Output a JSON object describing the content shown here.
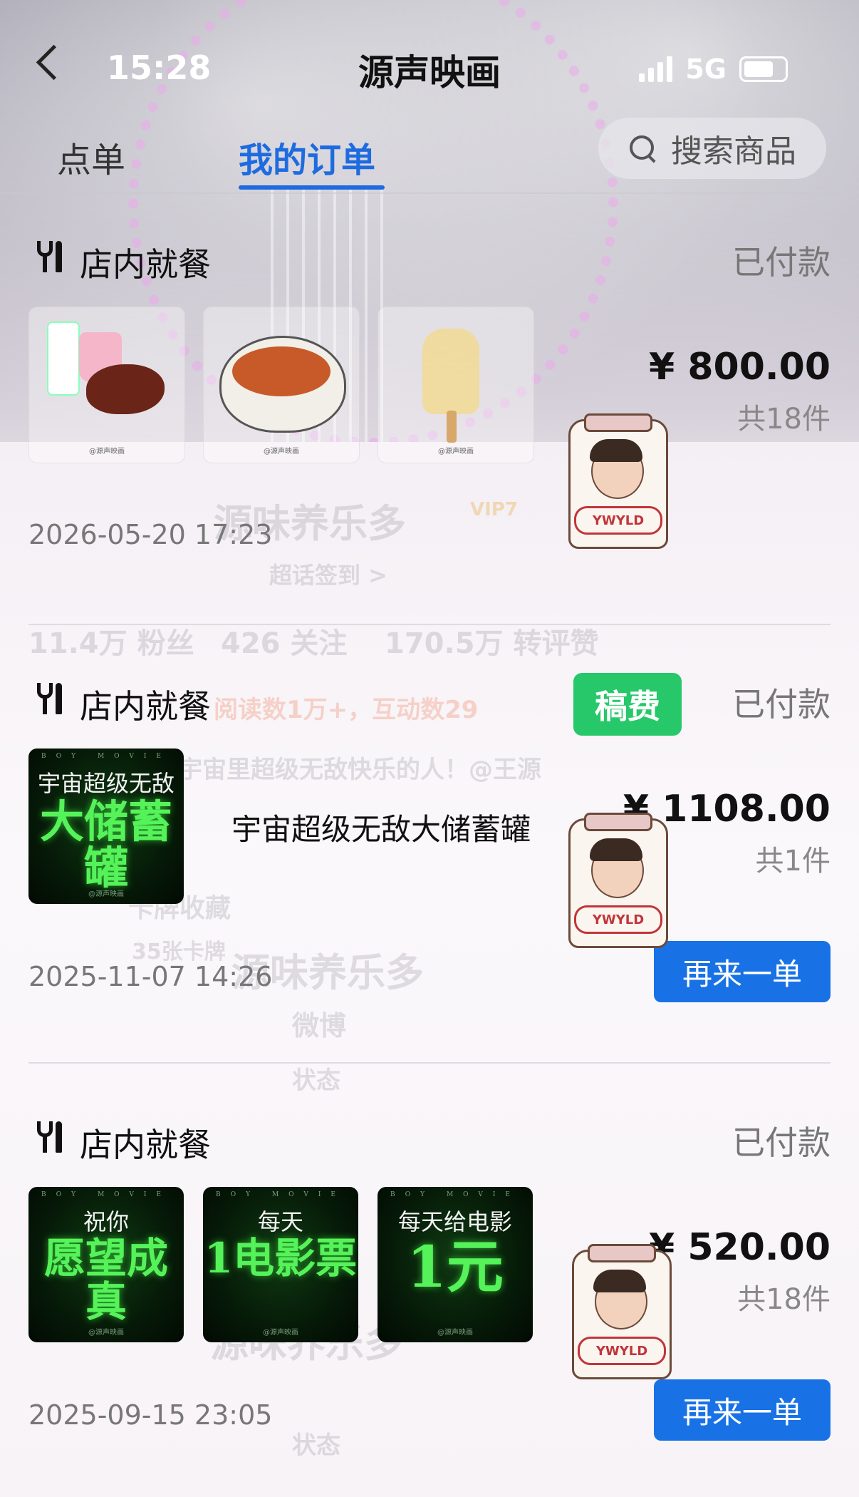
{
  "status_bar": {
    "time": "15:28",
    "network": "5G"
  },
  "header": {
    "title": "源声映画"
  },
  "tabs": {
    "order": "点单",
    "my_orders": "我的订单"
  },
  "search": {
    "placeholder": "搜索商品"
  },
  "background_ghost": {
    "name": "源味养乐多",
    "vip": "VIP7",
    "checkin": "超话签到 >",
    "fans": "11.4万 粉丝",
    "follow": "426 关注",
    "likes": "170.5万 转评赞",
    "reads": "阅读数1万+，互动数29",
    "bio": "宇宙里超级无敌快乐的人！@王源",
    "collect": "卡牌收藏",
    "cards": "35张卡牌",
    "weibo": "微博",
    "status": "状态"
  },
  "orders": [
    {
      "dine_type": "店内就餐",
      "status": "已付款",
      "price": "¥ 800.00",
      "qty": "共18件",
      "timestamp": "2026-05-20 17:23",
      "thumb_tag": "@源声映画"
    },
    {
      "dine_type": "店内就餐",
      "status": "已付款",
      "badge": "稿费",
      "item_name": "宇宙超级无敌大储蓄罐",
      "poster": {
        "line1": "宇宙超级无敌",
        "line2": "大储蓄罐",
        "top": "BOY MOVIE",
        "foot": "@源声映画"
      },
      "price": "¥ 1108.00",
      "qty": "共1件",
      "timestamp": "2025-11-07 14:26",
      "again": "再来一单"
    },
    {
      "dine_type": "店内就餐",
      "status": "已付款",
      "posters": [
        {
          "line1": "祝你",
          "line2": "愿望成真",
          "top": "BOY MOVIE",
          "foot": "@源声映画"
        },
        {
          "line1": "每天",
          "line2": "1电影票",
          "top": "BOY MOVIE",
          "foot": "@源声映画"
        },
        {
          "line1": "每天给电影",
          "line2": "1元",
          "top": "BOY MOVIE",
          "foot": "@源声映画"
        }
      ],
      "price": "¥ 520.00",
      "qty": "共18件",
      "timestamp": "2025-09-15 23:05",
      "again": "再来一单"
    }
  ],
  "sticker": {
    "label": "YWYLD"
  }
}
